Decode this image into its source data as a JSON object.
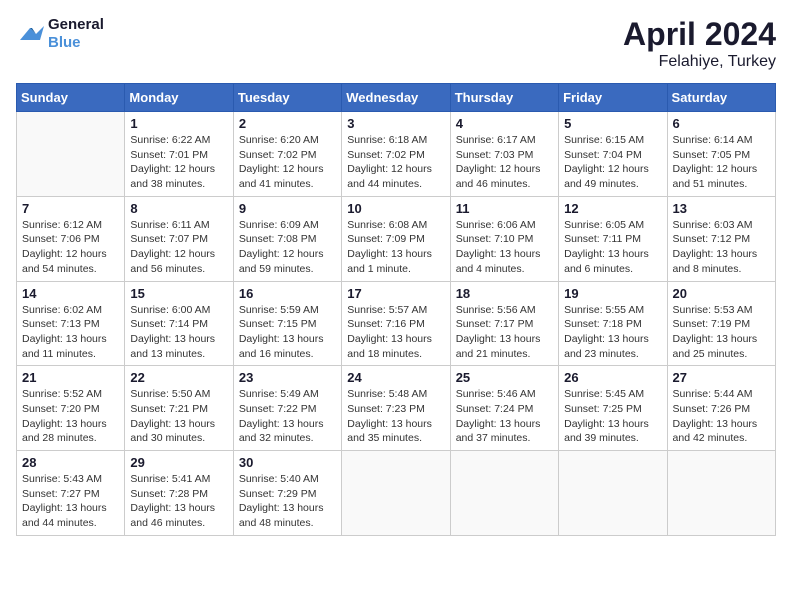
{
  "header": {
    "logo_line1": "General",
    "logo_line2": "Blue",
    "title": "April 2024",
    "subtitle": "Felahiye, Turkey"
  },
  "days_of_week": [
    "Sunday",
    "Monday",
    "Tuesday",
    "Wednesday",
    "Thursday",
    "Friday",
    "Saturday"
  ],
  "weeks": [
    [
      {
        "num": "",
        "info": ""
      },
      {
        "num": "1",
        "info": "Sunrise: 6:22 AM\nSunset: 7:01 PM\nDaylight: 12 hours\nand 38 minutes."
      },
      {
        "num": "2",
        "info": "Sunrise: 6:20 AM\nSunset: 7:02 PM\nDaylight: 12 hours\nand 41 minutes."
      },
      {
        "num": "3",
        "info": "Sunrise: 6:18 AM\nSunset: 7:02 PM\nDaylight: 12 hours\nand 44 minutes."
      },
      {
        "num": "4",
        "info": "Sunrise: 6:17 AM\nSunset: 7:03 PM\nDaylight: 12 hours\nand 46 minutes."
      },
      {
        "num": "5",
        "info": "Sunrise: 6:15 AM\nSunset: 7:04 PM\nDaylight: 12 hours\nand 49 minutes."
      },
      {
        "num": "6",
        "info": "Sunrise: 6:14 AM\nSunset: 7:05 PM\nDaylight: 12 hours\nand 51 minutes."
      }
    ],
    [
      {
        "num": "7",
        "info": "Sunrise: 6:12 AM\nSunset: 7:06 PM\nDaylight: 12 hours\nand 54 minutes."
      },
      {
        "num": "8",
        "info": "Sunrise: 6:11 AM\nSunset: 7:07 PM\nDaylight: 12 hours\nand 56 minutes."
      },
      {
        "num": "9",
        "info": "Sunrise: 6:09 AM\nSunset: 7:08 PM\nDaylight: 12 hours\nand 59 minutes."
      },
      {
        "num": "10",
        "info": "Sunrise: 6:08 AM\nSunset: 7:09 PM\nDaylight: 13 hours\nand 1 minute."
      },
      {
        "num": "11",
        "info": "Sunrise: 6:06 AM\nSunset: 7:10 PM\nDaylight: 13 hours\nand 4 minutes."
      },
      {
        "num": "12",
        "info": "Sunrise: 6:05 AM\nSunset: 7:11 PM\nDaylight: 13 hours\nand 6 minutes."
      },
      {
        "num": "13",
        "info": "Sunrise: 6:03 AM\nSunset: 7:12 PM\nDaylight: 13 hours\nand 8 minutes."
      }
    ],
    [
      {
        "num": "14",
        "info": "Sunrise: 6:02 AM\nSunset: 7:13 PM\nDaylight: 13 hours\nand 11 minutes."
      },
      {
        "num": "15",
        "info": "Sunrise: 6:00 AM\nSunset: 7:14 PM\nDaylight: 13 hours\nand 13 minutes."
      },
      {
        "num": "16",
        "info": "Sunrise: 5:59 AM\nSunset: 7:15 PM\nDaylight: 13 hours\nand 16 minutes."
      },
      {
        "num": "17",
        "info": "Sunrise: 5:57 AM\nSunset: 7:16 PM\nDaylight: 13 hours\nand 18 minutes."
      },
      {
        "num": "18",
        "info": "Sunrise: 5:56 AM\nSunset: 7:17 PM\nDaylight: 13 hours\nand 21 minutes."
      },
      {
        "num": "19",
        "info": "Sunrise: 5:55 AM\nSunset: 7:18 PM\nDaylight: 13 hours\nand 23 minutes."
      },
      {
        "num": "20",
        "info": "Sunrise: 5:53 AM\nSunset: 7:19 PM\nDaylight: 13 hours\nand 25 minutes."
      }
    ],
    [
      {
        "num": "21",
        "info": "Sunrise: 5:52 AM\nSunset: 7:20 PM\nDaylight: 13 hours\nand 28 minutes."
      },
      {
        "num": "22",
        "info": "Sunrise: 5:50 AM\nSunset: 7:21 PM\nDaylight: 13 hours\nand 30 minutes."
      },
      {
        "num": "23",
        "info": "Sunrise: 5:49 AM\nSunset: 7:22 PM\nDaylight: 13 hours\nand 32 minutes."
      },
      {
        "num": "24",
        "info": "Sunrise: 5:48 AM\nSunset: 7:23 PM\nDaylight: 13 hours\nand 35 minutes."
      },
      {
        "num": "25",
        "info": "Sunrise: 5:46 AM\nSunset: 7:24 PM\nDaylight: 13 hours\nand 37 minutes."
      },
      {
        "num": "26",
        "info": "Sunrise: 5:45 AM\nSunset: 7:25 PM\nDaylight: 13 hours\nand 39 minutes."
      },
      {
        "num": "27",
        "info": "Sunrise: 5:44 AM\nSunset: 7:26 PM\nDaylight: 13 hours\nand 42 minutes."
      }
    ],
    [
      {
        "num": "28",
        "info": "Sunrise: 5:43 AM\nSunset: 7:27 PM\nDaylight: 13 hours\nand 44 minutes."
      },
      {
        "num": "29",
        "info": "Sunrise: 5:41 AM\nSunset: 7:28 PM\nDaylight: 13 hours\nand 46 minutes."
      },
      {
        "num": "30",
        "info": "Sunrise: 5:40 AM\nSunset: 7:29 PM\nDaylight: 13 hours\nand 48 minutes."
      },
      {
        "num": "",
        "info": ""
      },
      {
        "num": "",
        "info": ""
      },
      {
        "num": "",
        "info": ""
      },
      {
        "num": "",
        "info": ""
      }
    ]
  ]
}
